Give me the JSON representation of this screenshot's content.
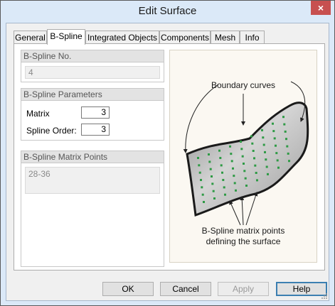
{
  "window": {
    "title": "Edit Surface",
    "close_glyph": "×"
  },
  "tabs": [
    {
      "label": "General"
    },
    {
      "label": "B-Spline"
    },
    {
      "label": "Integrated Objects"
    },
    {
      "label": "Components"
    },
    {
      "label": "Mesh"
    },
    {
      "label": "Info"
    }
  ],
  "bspline_no": {
    "header": "B-Spline No.",
    "value": "4"
  },
  "parameters": {
    "header": "B-Spline Parameters",
    "matrix_label": "Matrix",
    "matrix_value": "3",
    "order_label": "Spline Order:",
    "order_value": "3"
  },
  "matrix_points": {
    "header": "B-Spline Matrix Points",
    "value": "28-36"
  },
  "illustration": {
    "top_caption": "Boundary curves",
    "bottom_caption_line1": "B-Spline matrix points",
    "bottom_caption_line2": "defining the surface",
    "point_color": "#2e9a45"
  },
  "buttons": {
    "ok": "OK",
    "cancel": "Cancel",
    "apply": "Apply",
    "help": "Help"
  }
}
